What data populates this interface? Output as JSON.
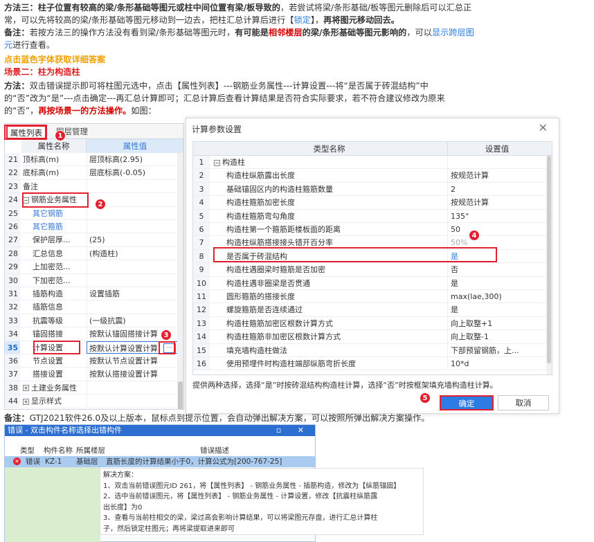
{
  "paragraphs": {
    "p1_lines": [
      [
        "b:方法三：柱子位置有较高的梁/条形基础等图元或柱中间位置有梁/板导致的",
        "t:，若尝试将梁/条形基础/板等图元删除后可以汇总正"
      ],
      [
        "t:常，可以先将较高的梁/条形基础等图元移动到一边去，把柱汇总计算后进行【",
        "l:锁定",
        "t:】，",
        "b:再将图元移动回去。"
      ],
      [
        "b:备注：",
        "t:若按方法三的操作方法没有看到梁/条形基础等图元时，",
        "b:有可能是",
        "r:相邻楼层",
        "b:的梁/条形基础等图元影响的",
        "t:，可以",
        "l:显示跨层图"
      ],
      [
        "l:元",
        "t:进行查看。"
      ]
    ],
    "orange_line": "点击蓝色字体获取详细答案",
    "scene2_title": "场景二：柱为构造柱",
    "p2_lines": [
      [
        "b:方法：",
        "t:双击错误提示即可将柱图元选中，点击【属性列表】---钢筋业务属性---计算设置---将“是否属于砖混结构”中"
      ],
      [
        "t:的“否”改为“是”---点击确定---再汇总计算即可；汇总计算后查看计算结果是否符合实际要求，若不符合建议修改为原来"
      ],
      [
        "t:的“否”，",
        "r:再按场景一的方法操作。",
        "t:如图："
      ]
    ],
    "note_line": [
      "b:备注：",
      "t:GTJ2021软件26.0及以上版本，鼠标点到提示位置，会自动弹出解决方案，可以按照所弹出解决方案操作。"
    ]
  },
  "prop_panel": {
    "tab_active": "属性列表",
    "tab_other": "图层管理",
    "col_name": "属性名称",
    "col_value": "属性值",
    "rows": [
      {
        "n": "21",
        "name": "顶标高(m)",
        "value": "层顶标高(2.95)"
      },
      {
        "n": "22",
        "name": "底标高(m)",
        "value": "层底标高(-0.05)"
      },
      {
        "n": "23",
        "name": "备注",
        "value": ""
      },
      {
        "n": "24",
        "name": "钢筋业务属性",
        "value": ""
      },
      {
        "n": "25",
        "name": "其它钢筋",
        "value": ""
      },
      {
        "n": "26",
        "name": "其它箍筋",
        "value": ""
      },
      {
        "n": "27",
        "name": "保护层厚...",
        "value": "(25)"
      },
      {
        "n": "28",
        "name": "汇总信息",
        "value": "(构造柱)"
      },
      {
        "n": "29",
        "name": "上加密范...",
        "value": ""
      },
      {
        "n": "30",
        "name": "下加密范...",
        "value": ""
      },
      {
        "n": "31",
        "name": "插筋构造",
        "value": "设置插筋"
      },
      {
        "n": "32",
        "name": "插筋信息",
        "value": ""
      },
      {
        "n": "33",
        "name": "抗震等级",
        "value": "(一级抗震)"
      },
      {
        "n": "34",
        "name": "锚固搭接",
        "value": "按默认锚固搭接计算"
      },
      {
        "n": "35",
        "name": "计算设置",
        "value": "按默认计算设置计算"
      },
      {
        "n": "36",
        "name": "节点设置",
        "value": "按默认节点设置计算"
      },
      {
        "n": "37",
        "name": "搭接设置",
        "value": "按默认搭接设置计算"
      },
      {
        "n": "38",
        "name": "土建业务属性",
        "value": ""
      },
      {
        "n": "44",
        "name": "显示样式",
        "value": ""
      }
    ],
    "ellipsis": "···"
  },
  "markers": [
    "1",
    "2",
    "3",
    "4",
    "5"
  ],
  "dialog": {
    "title": "计算参数设置",
    "close": "✕",
    "col_type": "类型名称",
    "col_value": "设置值",
    "rows": [
      {
        "n": "1",
        "name": "构造柱",
        "value": ""
      },
      {
        "n": "2",
        "name": "构造柱纵筋露出长度",
        "value": "按规范计算"
      },
      {
        "n": "3",
        "name": "基础锚固区内的构造柱箍筋数量",
        "value": "2"
      },
      {
        "n": "4",
        "name": "构造柱箍筋加密长度",
        "value": "按规范计算"
      },
      {
        "n": "5",
        "name": "构造柱箍筋弯勾角度",
        "value": "135°"
      },
      {
        "n": "6",
        "name": "构造柱第一个箍筋距楼板面的距离",
        "value": "50"
      },
      {
        "n": "7",
        "name": "构造柱纵筋搭接接头错开百分率",
        "value": "50%"
      },
      {
        "n": "8",
        "name": "是否属于砖混结构",
        "value": "是"
      },
      {
        "n": "9",
        "name": "构造柱遇圈梁时箍筋是否加密",
        "value": "否"
      },
      {
        "n": "10",
        "name": "构造柱遇非圈梁是否贯通",
        "value": "是"
      },
      {
        "n": "11",
        "name": "圆形箍筋的搭接长度",
        "value": "max(lae,300)"
      },
      {
        "n": "12",
        "name": "螺旋箍筋是否连续通过",
        "value": "是"
      },
      {
        "n": "13",
        "name": "构造柱箍筋加密区根数计算方式",
        "value": "向上取整+1"
      },
      {
        "n": "14",
        "name": "构造柱箍筋非加密区根数计算方式",
        "value": "向上取整-1"
      },
      {
        "n": "15",
        "name": "填充墙构造柱做法",
        "value": "下部预留钢筋，上..."
      },
      {
        "n": "16",
        "name": "使用预埋件时构造柱端部纵筋弯折长度",
        "value": "10*d"
      }
    ],
    "tip": "提供两种选择，选择“是”时按砖混结构构造柱计算，选择“否”时按框架填充墙构造柱计算。",
    "ok": "确定",
    "cancel": "取消"
  },
  "error_window": {
    "title": "错误 - 双击构件名称选择出错构件",
    "title_buttons": "▫ ✕",
    "col_type": "类型",
    "col_name": "构件名称",
    "col_floor": "所属楼层",
    "col_desc": "错误描述",
    "row": {
      "type": "错误",
      "name": "KZ-1",
      "floor": "基础层",
      "desc": "直筋长度的计算结果小于0，计算公式为[200-767-25]"
    },
    "solution_lines": [
      "解决方案：",
      "1、双击当前错误图元ID 261，将【属性列表】 - 钢筋业务属性 - 插筋构造，修改为【纵筋锚固】",
      "2、选中当前错误图元，将【属性列表】 - 钢筋业务属性 - 计算设置，修改【抗震柱纵筋露",
      "出长度】为0",
      "3、查看与当前柱相交的梁，梁过高会影响计算结果，可以将梁图元存盘，进行汇总计算柱",
      "子，然后锁定柱图元；再将梁提取进来即可"
    ]
  }
}
